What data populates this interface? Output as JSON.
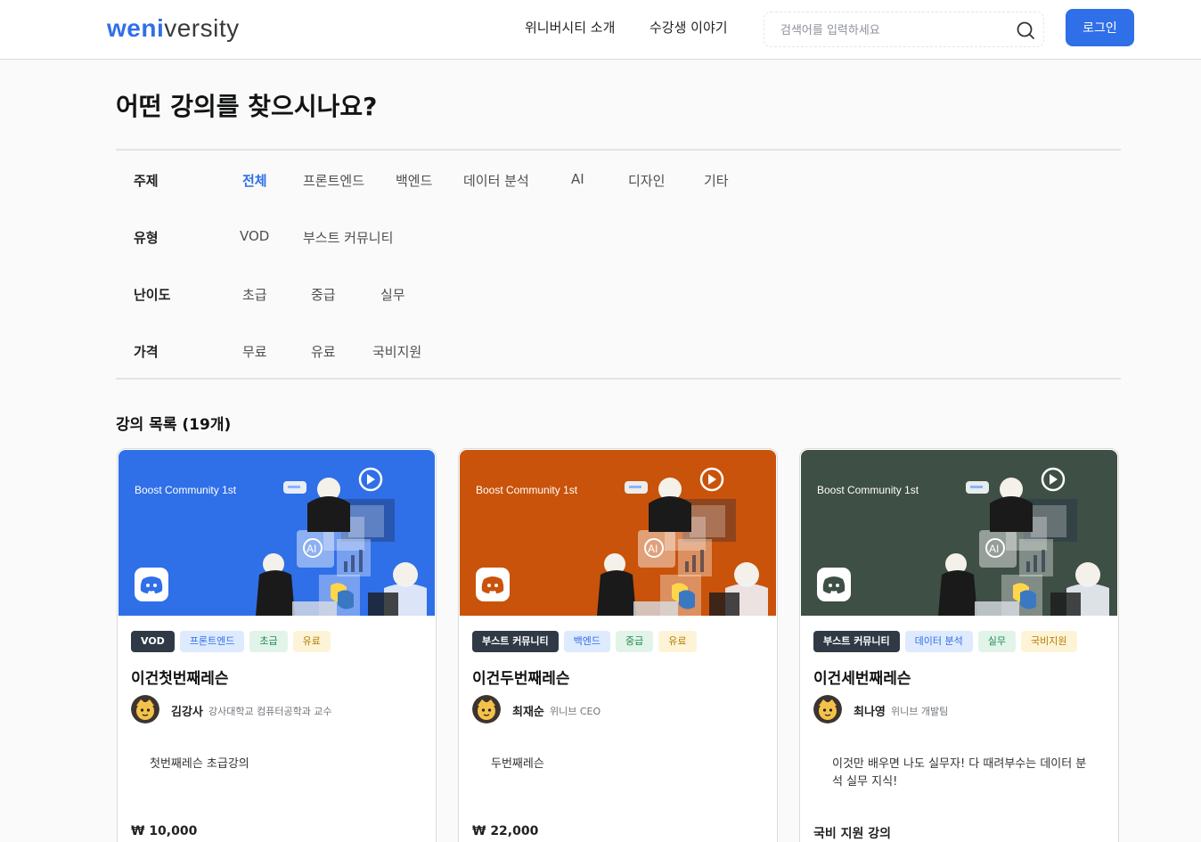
{
  "header": {
    "logo_prefix": "weni",
    "logo_suffix": "versity",
    "nav": [
      "위니버시티 소개",
      "수강생 이야기"
    ],
    "search_placeholder": "검색어를 입력하세요",
    "login_label": "로그인"
  },
  "page_title": "어떤 강의를 찾으시나요?",
  "filters": {
    "topic": {
      "label": "주제",
      "options": [
        "전체",
        "프론트엔드",
        "백엔드",
        "데이터 분석",
        "AI",
        "디자인",
        "기타"
      ],
      "active": "전체"
    },
    "type": {
      "label": "유형",
      "options": [
        "VOD",
        "부스트 커뮤니티"
      ]
    },
    "level": {
      "label": "난이도",
      "options": [
        "초급",
        "중급",
        "실무"
      ]
    },
    "price": {
      "label": "가격",
      "options": [
        "무료",
        "유료",
        "국비지원"
      ]
    }
  },
  "list_title": "강의 목록 (19개)",
  "colors": {
    "accent": "#2f6fe8",
    "card1": "#2f6fe8",
    "card2": "#c9530a",
    "card3": "#3e4f45"
  },
  "courses": [
    {
      "banner_text": "Boost Community 1st",
      "tags": [
        "VOD",
        "프론트엔드",
        "초급",
        "유료"
      ],
      "title": "이건첫번째레슨",
      "author": "김강사",
      "author_desc": "강사대학교 컴퓨터공학과 교수",
      "desc": "첫번째레슨 초급강의",
      "price": "₩ 10,000"
    },
    {
      "banner_text": "Boost Community 1st",
      "tags": [
        "부스트 커뮤니티",
        "백엔드",
        "중급",
        "유료"
      ],
      "title": "이건두번째레슨",
      "author": "최재순",
      "author_desc": "위니브 CEO",
      "desc": "두번째레슨",
      "price": "₩ 22,000"
    },
    {
      "banner_text": "Boost Community 1st",
      "tags": [
        "부스트 커뮤니티",
        "데이터 분석",
        "실무",
        "국비지원"
      ],
      "title": "이건세번째레슨",
      "author": "최나영",
      "author_desc": "위니브 개발팀",
      "desc": "이것만 배우면 나도 실무자! 다 때려부수는 데이터 분석 실무 지식!",
      "price": "국비 지원 강의"
    }
  ]
}
